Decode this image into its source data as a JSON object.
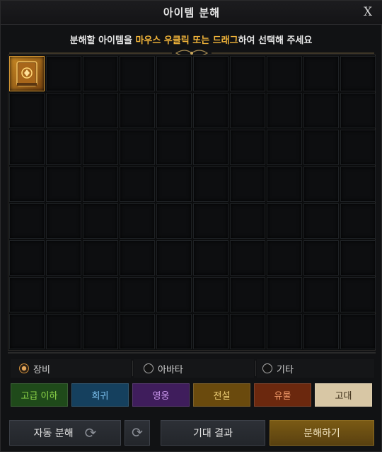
{
  "window": {
    "title": "아이템 분해",
    "close_glyph": "X"
  },
  "instruction": {
    "part1": "분해할 아이템을 ",
    "highlight": "마우스 우클릭 또는 드래그",
    "part2": "하여 선택해 주세요"
  },
  "grid": {
    "columns": 10,
    "rows": 8,
    "filled_slots": [
      {
        "index": 0,
        "icon": "book-item-icon"
      }
    ]
  },
  "categories": [
    {
      "label": "장비",
      "selected": true
    },
    {
      "label": "아바타",
      "selected": false
    },
    {
      "label": "기타",
      "selected": false
    }
  ],
  "grades": [
    {
      "label": "고급 이하",
      "bg": "#1f4a1a",
      "fg": "#8fd84a"
    },
    {
      "label": "희귀",
      "bg": "#15405e",
      "fg": "#7fc4f2"
    },
    {
      "label": "영웅",
      "bg": "#3f1d5c",
      "fg": "#cf9af2"
    },
    {
      "label": "전설",
      "bg": "#6a4a0d",
      "fg": "#f2d27a"
    },
    {
      "label": "유물",
      "bg": "#6b280e",
      "fg": "#f29b6a"
    },
    {
      "label": "고대",
      "bg": "#d8c7a5",
      "fg": "#3b2d16"
    }
  ],
  "actions": {
    "auto_disassemble_label": "자동 분해",
    "refresh_icon": "refresh-icon",
    "auto_refresh_icon": "refresh-settings-icon",
    "expected_result_label": "기대 결과",
    "disassemble_label": "분해하기"
  },
  "colors": {
    "accent_gold": "#f2b53a",
    "frame": "#2b2a28"
  }
}
